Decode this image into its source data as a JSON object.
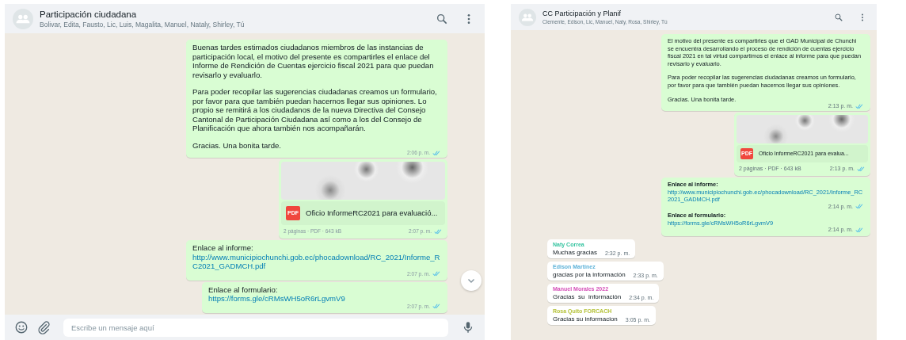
{
  "panels": [
    {
      "header": {
        "title": "Participación ciudadana",
        "subtitle": "Bolivar, Edita, Fausto, Lic, Luis, Magalita, Manuel, Nataly, Shirley, Tú"
      },
      "messages": [
        {
          "kind": "text",
          "paragraphs": [
            "Buenas tardes estimados ciudadanos miembros de las instancias de participación local, el motivo del presente es compartirles el enlace del Informe de Rendición de Cuentas ejercicio fiscal 2021 para que puedan revisarlo y evaluarlo.",
            "Para poder recopilar las sugerencias ciudadanas creamos un formulario, por favor para que también puedan hacernos llegar sus opiniones. Lo propio se remitirá a los ciudadanos de la nueva Directiva del Consejo Cantonal de Participación Ciudadana así como a los del Consejo de Planificación que ahora también nos acompañarán.",
            "Gracias. Una bonita tarde."
          ],
          "time": "2:06 p. m.",
          "read": true
        },
        {
          "kind": "document",
          "icon_label": "PDF",
          "file_name": "Oficio InformeRC2021 para evaluació...",
          "details": "2 páginas · PDF · 643 kB",
          "time": "2:07 p. m.",
          "read": true
        },
        {
          "kind": "links",
          "items": [
            {
              "label": "Enlace al informe:",
              "url": "http://www.municipiochunchi.gob.ec/phocadownload/RC_2021/Informe_RC2021_GADMCH.pdf",
              "time": "2:07 p. m."
            }
          ],
          "read": true
        },
        {
          "kind": "links",
          "items": [
            {
              "label": "Enlace al formulario:",
              "url": "https://forms.gle/cRMsWH5oR6rLgvmV9",
              "time": "2:07 p. m."
            }
          ],
          "read": true
        }
      ],
      "scroll_down_button": true,
      "composer": {
        "placeholder": "Escribe un mensaje aquí"
      }
    },
    {
      "header": {
        "title": "CC Participación y Planif",
        "subtitle": "Clemente, Edison, Lic, Manuel, Naty, Rosa, Shirley, Tú"
      },
      "messages": [
        {
          "kind": "text",
          "paragraphs": [
            "El motivo del presente es compartirles que el GAD Municipal de Chunchi se encuentra desarrollando el proceso de rendición de cuentas ejercicio fiscal 2021 en tal virtud compartimos el enlace al informe para que puedan revisarlo y evaluarlo.",
            "Para poder recopilar las sugerencias ciudadanas creamos un formulario, por favor para que también puedan hacernos llegar sus opiniones.",
            "Gracias. Una bonita tarde."
          ],
          "time": "2:13 p. m.",
          "read": true
        },
        {
          "kind": "document",
          "icon_label": "PDF",
          "file_name": "Oficio InformeRC2021 para evalua...",
          "details": "2 páginas · PDF · 643 kB",
          "time": "2:13 p. m.",
          "read": true
        },
        {
          "kind": "links",
          "items": [
            {
              "label": "Enlace al informe:",
              "url": "http://www.municipiochunchi.gob.ec/phocadownload/RC_2021/Informe_RC2021_GADMCH.pdf",
              "time": "2:14 p. m."
            },
            {
              "label": "Enlace al formulario:",
              "url": "https://forms.gle/cRMsWH5oR6rLgvmV9",
              "time": "2:14 p. m."
            }
          ],
          "read": true
        },
        {
          "kind": "incoming",
          "sender": "Naty Correa",
          "color": "#35c4a0",
          "text": "Muchas gracias",
          "time": "2:32 p. m."
        },
        {
          "kind": "incoming",
          "sender": "Edison Martínez",
          "color": "#5fb3d9",
          "text": "gracias por la información",
          "time": "2:33 p. m."
        },
        {
          "kind": "incoming",
          "sender": "Manuel Morales 2022",
          "color": "#d54fb8",
          "text": "Gracias  su  información",
          "time": "2:34 p. m."
        },
        {
          "kind": "incoming",
          "sender": "Rosa Quito FORCACH",
          "color": "#b5c23a",
          "text": "Gracias su informacion",
          "time": "3:05 p. m."
        }
      ],
      "scroll_down_button": false
    }
  ]
}
